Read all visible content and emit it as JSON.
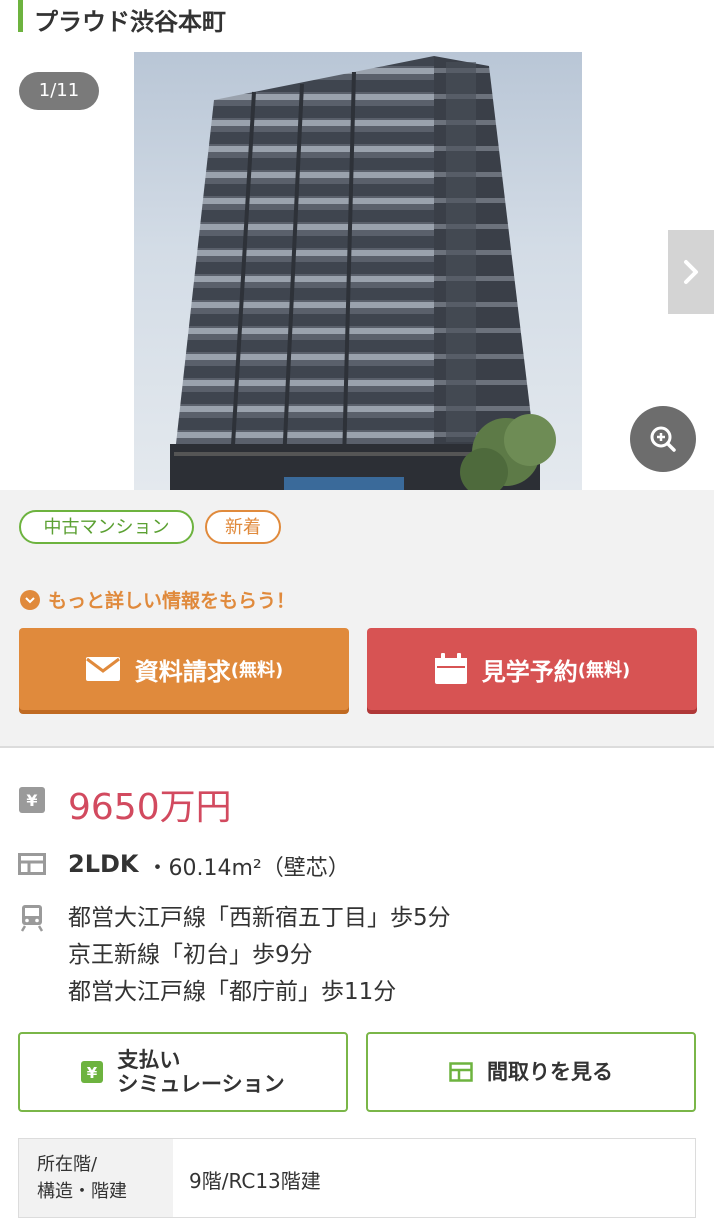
{
  "property": {
    "name": "プラウド渋谷本町"
  },
  "gallery": {
    "counter": "1/11"
  },
  "tags": {
    "used": "中古マンション",
    "new": "新着"
  },
  "info_prompt": "もっと詳しい情報をもらう！",
  "cta": {
    "request": {
      "label": "資料請求",
      "sub": "(無料)"
    },
    "visit": {
      "label": "見学予約",
      "sub": "(無料)"
    }
  },
  "price": "9650万円",
  "layout": {
    "type": "2LDK",
    "area": "・60.14m²（壁芯）"
  },
  "stations": [
    "都営大江戸線「西新宿五丁目」歩5分",
    "京王新線「初台」歩9分",
    "都営大江戸線「都庁前」歩11分"
  ],
  "buttons": {
    "payment": {
      "line1": "支払い",
      "line2": "シミュレーション"
    },
    "floorplan": {
      "label": "間取りを見る"
    }
  },
  "specs": {
    "floor_header_1": "所在階/",
    "floor_header_2": "構造・階建",
    "floor_value": "9階/RC13階建"
  },
  "colors": {
    "green": "#6db33f",
    "orange": "#e08a3c",
    "red": "#d75353",
    "price": "#d24a5f"
  }
}
